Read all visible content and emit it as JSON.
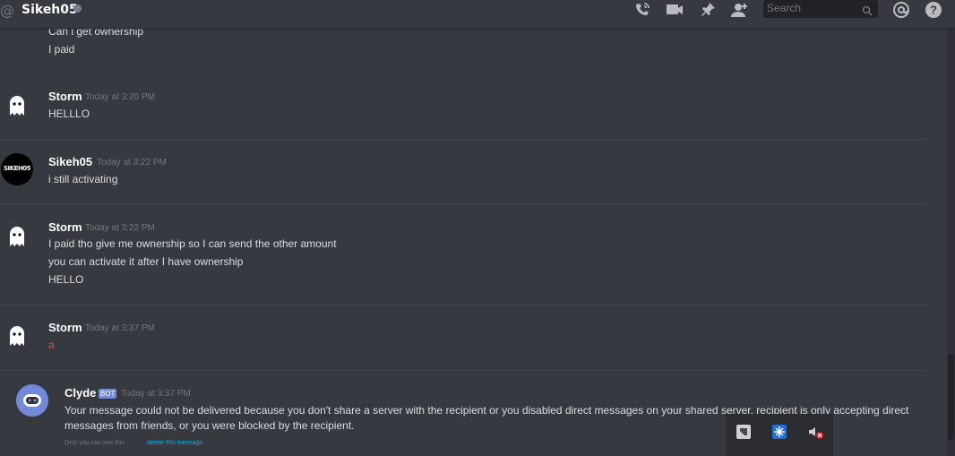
{
  "header": {
    "channel_name": "Sikeh05",
    "search_placeholder": "Search"
  },
  "icons": {
    "at": "at-icon",
    "call": "phone-call-icon",
    "video": "video-icon",
    "pin": "pin-icon",
    "add_user": "add-friend-icon",
    "mention": "mention-icon",
    "help": "help-icon"
  },
  "messages": [
    {
      "lines": [
        "Can i get ownership",
        "I paid"
      ]
    },
    {
      "author": "Storm",
      "timestamp": "Today at 3:20 PM",
      "lines": [
        "HELLLO"
      ]
    },
    {
      "author": "Sikeh05",
      "timestamp": "Today at 3:22 PM",
      "avatar_text": "SIKEH05",
      "lines": [
        "i still activating"
      ]
    },
    {
      "author": "Storm",
      "timestamp": "Today at 3:22 PM",
      "lines": [
        "I paid tho give me ownership so I can send the other amount",
        "you can activate it after I have ownership",
        "HELLO"
      ]
    },
    {
      "author": "Storm",
      "timestamp": "Today at 3:37 PM",
      "lines": [
        "a"
      ]
    },
    {
      "author": "Clyde",
      "badge": "BOT",
      "timestamp": "Today at 3:37 PM",
      "text": "Your message could not be delivered because you don't share a server with the recipient or you disabled direct messages on your shared server, recipient is only accepting direct messages from friends, or you were blocked by the recipient.",
      "only_you": "Only you can see this",
      "delete_link": "delete this message"
    }
  ],
  "colors": {
    "background": "#36393f",
    "accent": "#7289da",
    "error_text": "#f04747"
  }
}
